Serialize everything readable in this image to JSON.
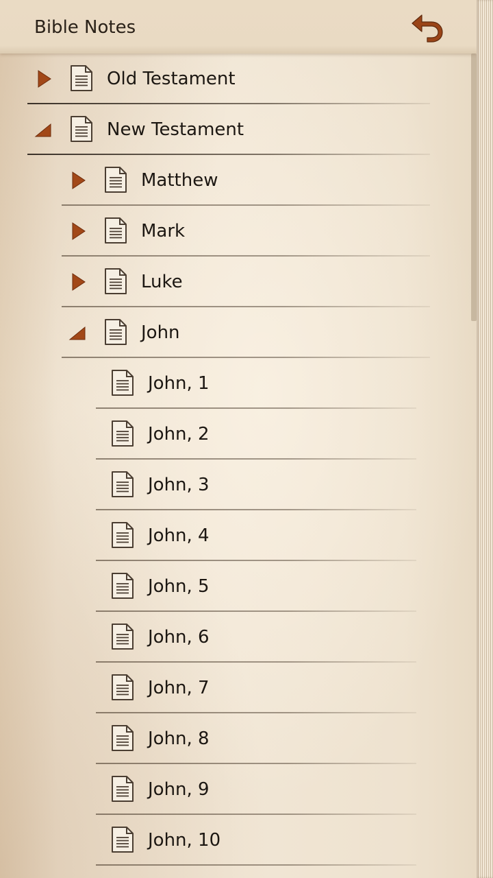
{
  "header": {
    "title": "Bible Notes",
    "back_icon": "undo-arrow-icon"
  },
  "colors": {
    "accent": "#9a4418",
    "text": "#1c1712"
  },
  "tree": [
    {
      "label": "Old Testament",
      "level": 0,
      "expander": "collapsed"
    },
    {
      "label": "New Testament",
      "level": 0,
      "expander": "expanded"
    },
    {
      "label": "Matthew",
      "level": 1,
      "expander": "collapsed"
    },
    {
      "label": "Mark",
      "level": 1,
      "expander": "collapsed"
    },
    {
      "label": "Luke",
      "level": 1,
      "expander": "collapsed"
    },
    {
      "label": "John",
      "level": 1,
      "expander": "expanded"
    },
    {
      "label": "John, 1",
      "level": 2,
      "expander": "none"
    },
    {
      "label": "John, 2",
      "level": 2,
      "expander": "none"
    },
    {
      "label": "John, 3",
      "level": 2,
      "expander": "none"
    },
    {
      "label": "John, 4",
      "level": 2,
      "expander": "none"
    },
    {
      "label": "John, 5",
      "level": 2,
      "expander": "none"
    },
    {
      "label": "John, 6",
      "level": 2,
      "expander": "none"
    },
    {
      "label": "John, 7",
      "level": 2,
      "expander": "none"
    },
    {
      "label": "John, 8",
      "level": 2,
      "expander": "none"
    },
    {
      "label": "John, 9",
      "level": 2,
      "expander": "none"
    },
    {
      "label": "John, 10",
      "level": 2,
      "expander": "none"
    }
  ]
}
